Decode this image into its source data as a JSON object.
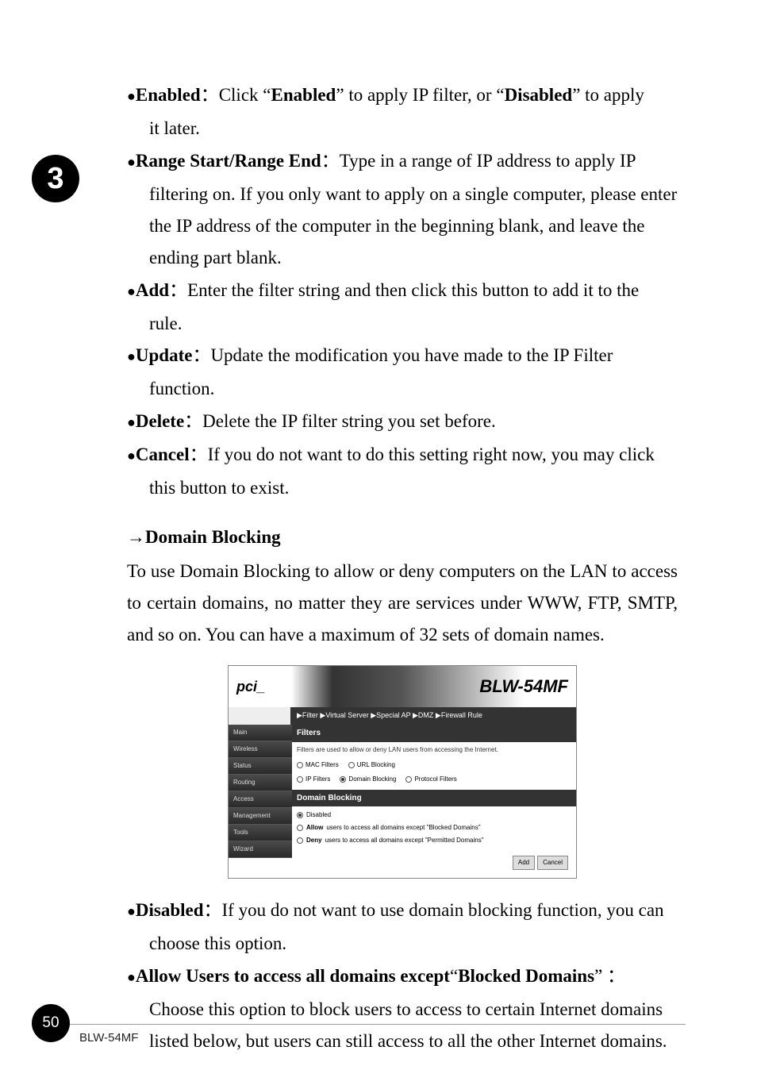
{
  "chapter": "3",
  "bullets": {
    "enabled": {
      "label": "Enabled",
      "pre": "：Click ",
      "quote_open": "“",
      "inner": "Enabled",
      "quote_close": "”",
      "mid": " to apply IP filter, or ",
      "inner2": "Disabled",
      "tail": " to apply",
      "cont": "it later."
    },
    "range": {
      "label": "Range Start/Range End",
      "tail1": "：Type in a range of IP address to apply IP",
      "cont1": "filtering on. If you only want to apply on a single computer, please enter",
      "cont2": "the IP address of the computer in the beginning blank, and leave the",
      "cont3": "ending part blank."
    },
    "add": {
      "label": "Add",
      "tail": "：Enter the filter string and then click this button to add it to the",
      "cont": "rule."
    },
    "update": {
      "label": "Update",
      "tail": "：Update the modification you have made to the IP Filter",
      "cont": "function."
    },
    "delete": {
      "label": "Delete",
      "tail": "：Delete the IP filter string you set before."
    },
    "cancel": {
      "label": "Cancel",
      "tail": "：If you do not want to do this setting right now, you may click",
      "cont": "this button to exist."
    },
    "disabled": {
      "label": "Disabled",
      "tail": "：If you do not want to use domain blocking function, you can",
      "cont": "choose this option."
    },
    "allow": {
      "label_pre": "Allow Users to access all domains except",
      "quote_open": "“",
      "inner": "Blocked Domains",
      "quote_close": "”",
      "tail": " ：",
      "cont1": "Choose this option to block users to access to certain Internet domains",
      "cont2": "listed below, but users can still access to all the other Internet domains."
    }
  },
  "section": {
    "arrow": "→",
    "title": "Domain Blocking",
    "para1": "To use Domain Blocking to allow or deny computers on the LAN to access",
    "para2": "to certain domains, no matter they are services under WWW, FTP, SMTP,",
    "para3": "and so on. You can have a maximum of 32 sets of domain names."
  },
  "screenshot": {
    "logo": "pci_",
    "model": "BLW-54MF",
    "breadcrumb": "▶Filter ▶Virtual Server ▶Special AP ▶DMZ ▶Firewall Rule",
    "nav": [
      "Main",
      "Wireless",
      "Status",
      "Routing",
      "Access",
      "Management",
      "Tools",
      "Wizard"
    ],
    "filters_hdr": "Filters",
    "filters_desc": "Filters are used to allow or deny LAN users from accessing the Internet.",
    "radio_mac": "MAC Filters",
    "radio_url": "URL Blocking",
    "radio_ip": "IP Filters",
    "radio_domain": "Domain Blocking",
    "radio_protocol": "Protocol Filters",
    "block_hdr": "Domain Blocking",
    "opt_disabled": "Disabled",
    "opt_allow_pre": "Allow",
    "opt_allow": " users to access all domains except \"Blocked Domains\"",
    "opt_deny_pre": "Deny",
    "opt_deny": " users to access all domains except \"Permitted Domains\"",
    "btn_add": "Add",
    "btn_cancel": "Cancel"
  },
  "footer": {
    "page": "50",
    "model": "BLW-54MF"
  }
}
